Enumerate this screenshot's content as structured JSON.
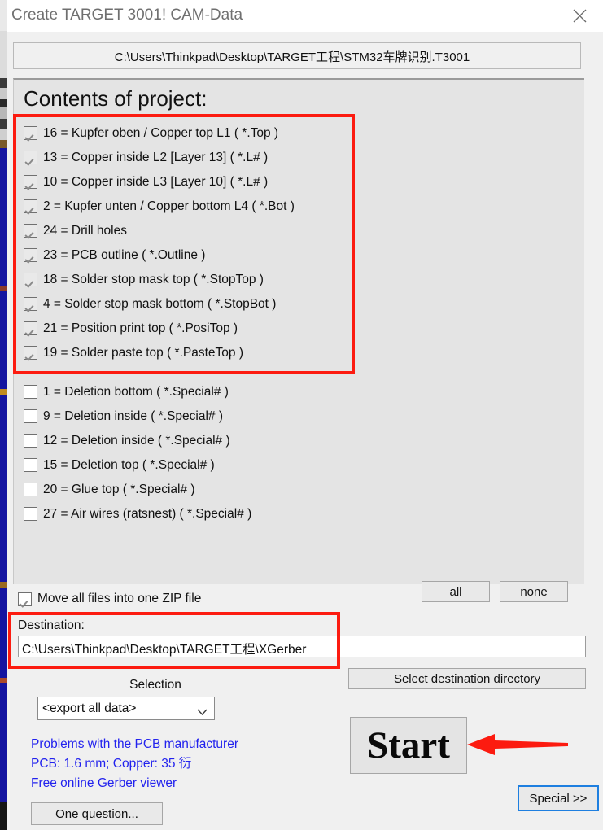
{
  "window": {
    "title": "Create TARGET 3001! CAM-Data",
    "close_icon": "close-icon",
    "project_path": "C:\\Users\\Thinkpad\\Desktop\\TARGET工程\\STM32车牌识别.T3001"
  },
  "contents": {
    "heading": "Contents of project:",
    "checked_items": [
      {
        "label": "16 = Kupfer oben / Copper top L1   ( *.Top )",
        "checked": true
      },
      {
        "label": "13 = Copper inside L2   [Layer 13]   ( *.L# )",
        "checked": true
      },
      {
        "label": "10 = Copper inside L3   [Layer 10]   ( *.L# )",
        "checked": true
      },
      {
        "label": "2 = Kupfer unten / Copper bottom L4   ( *.Bot )",
        "checked": true
      },
      {
        "label": "24 = Drill holes",
        "checked": true
      },
      {
        "label": "23 = PCB outline   ( *.Outline )",
        "checked": true
      },
      {
        "label": "18 = Solder stop mask top   ( *.StopTop )",
        "checked": true
      },
      {
        "label": "4 = Solder stop mask bottom   ( *.StopBot )",
        "checked": true
      },
      {
        "label": "21 = Position print top   ( *.PosiTop )",
        "checked": true
      },
      {
        "label": "19 = Solder paste top   ( *.PasteTop )",
        "checked": true
      }
    ],
    "unchecked_items": [
      {
        "label": "1 = Deletion bottom   ( *.Special# )",
        "checked": false
      },
      {
        "label": "9 = Deletion inside   ( *.Special# )",
        "checked": false
      },
      {
        "label": "12 = Deletion inside   ( *.Special# )",
        "checked": false
      },
      {
        "label": "15 = Deletion top   ( *.Special# )",
        "checked": false
      },
      {
        "label": "20 = Glue top   ( *.Special# )",
        "checked": false
      },
      {
        "label": "27 = Air wires (ratsnest)   ( *.Special# )",
        "checked": false
      }
    ]
  },
  "options": {
    "zip_label": "Move all files into one ZIP file",
    "zip_checked": true,
    "all_button": "all",
    "none_button": "none"
  },
  "destination": {
    "label": "Destination:",
    "value": "C:\\Users\\Thinkpad\\Desktop\\TARGET工程\\XGerber",
    "select_dir_button": "Select destination directory"
  },
  "selection": {
    "label": "Selection",
    "value": "<export all data>",
    "chevron_icon": "chevron-down-icon"
  },
  "links": [
    "Problems with the PCB manufacturer",
    "PCB: 1.6 mm; Copper: 35 衍",
    "Free online Gerber viewer"
  ],
  "actions": {
    "question_button": "One question...",
    "start_button": "Start",
    "special_button": "Special >>"
  },
  "annotations": {
    "arrow_icon": "red-arrow-left-icon",
    "highlight_color": "#fc1b10",
    "focus_color": "#1e7fe0",
    "link_color": "#2222ee"
  }
}
